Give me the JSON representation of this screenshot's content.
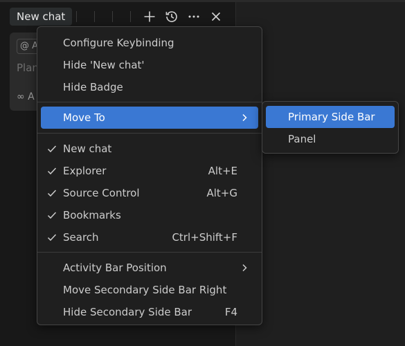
{
  "panel": {
    "tab_label": "New chat",
    "composer": {
      "context_chip": "@ A",
      "placeholder": "Plan",
      "mode_label": "∞ A"
    },
    "toolbar_icons": [
      "plus-icon",
      "history-icon",
      "more-icon",
      "close-icon"
    ]
  },
  "menu": {
    "groups": [
      {
        "items": [
          {
            "label": "Configure Keybinding"
          },
          {
            "label": "Hide 'New chat'"
          },
          {
            "label": "Hide Badge"
          }
        ]
      },
      {
        "items": [
          {
            "label": "Move To",
            "submenu": true,
            "active": true
          }
        ]
      },
      {
        "items": [
          {
            "label": "New chat",
            "checked": true,
            "shortcut": ""
          },
          {
            "label": "Explorer",
            "checked": true,
            "shortcut": "Alt+E"
          },
          {
            "label": "Source Control",
            "checked": true,
            "shortcut": "Alt+G"
          },
          {
            "label": "Bookmarks",
            "checked": true,
            "shortcut": ""
          },
          {
            "label": "Search",
            "checked": true,
            "shortcut": "Ctrl+Shift+F"
          }
        ]
      },
      {
        "items": [
          {
            "label": "Activity Bar Position",
            "submenu": true
          },
          {
            "label": "Move Secondary Side Bar Right"
          },
          {
            "label": "Hide Secondary Side Bar",
            "shortcut": "F4"
          }
        ]
      }
    ]
  },
  "submenu": {
    "items": [
      {
        "label": "Primary Side Bar",
        "active": true
      },
      {
        "label": "Panel"
      }
    ]
  },
  "colors": {
    "menu_background": "#1f1f1f",
    "menu_border": "#454545",
    "highlight": "#3a78d3",
    "text": "#cccccc"
  }
}
